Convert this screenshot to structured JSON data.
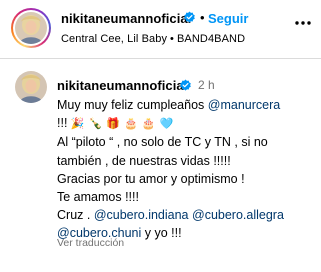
{
  "header": {
    "username": "nikitaneumannoficial",
    "separator": "•",
    "follow_label": "Seguir",
    "music_artists": "Central Cee, Lil Baby",
    "music_separator": "•",
    "music_title": "BAND4BAND",
    "more_icon": "more-horizontal-icon"
  },
  "comment": {
    "username": "nikitaneumannoficial",
    "time": "2 h",
    "line1_text": "Muy muy feliz cumpleaños ",
    "line1_mention": "@manurcera",
    "line2_text": "!!! ",
    "line2_emojis": "🎉 🍾 🎁 🎂 🎂 🩵",
    "line3": "Al “piloto “ , no solo de TC y TN , si no",
    "line4": "también , de nuestras vidas !!!!!",
    "line5": "Gracias por tu amor y optimismo !",
    "line6": "Te amamos !!!!",
    "line7_prefix": "Cruz . ",
    "line7_mention1": "@cubero.indiana",
    "line7_space": " ",
    "line7_mention2": "@cubero.allegra",
    "line8_mention": "@cubero.chuni",
    "line8_suffix": " y yo !!!",
    "see_translation": "Ver traducción"
  },
  "colors": {
    "follow_blue": "#0095f6",
    "mention": "#00376b",
    "verified": "#0095f6",
    "muted": "#737373",
    "divider": "#dbdbdb"
  }
}
